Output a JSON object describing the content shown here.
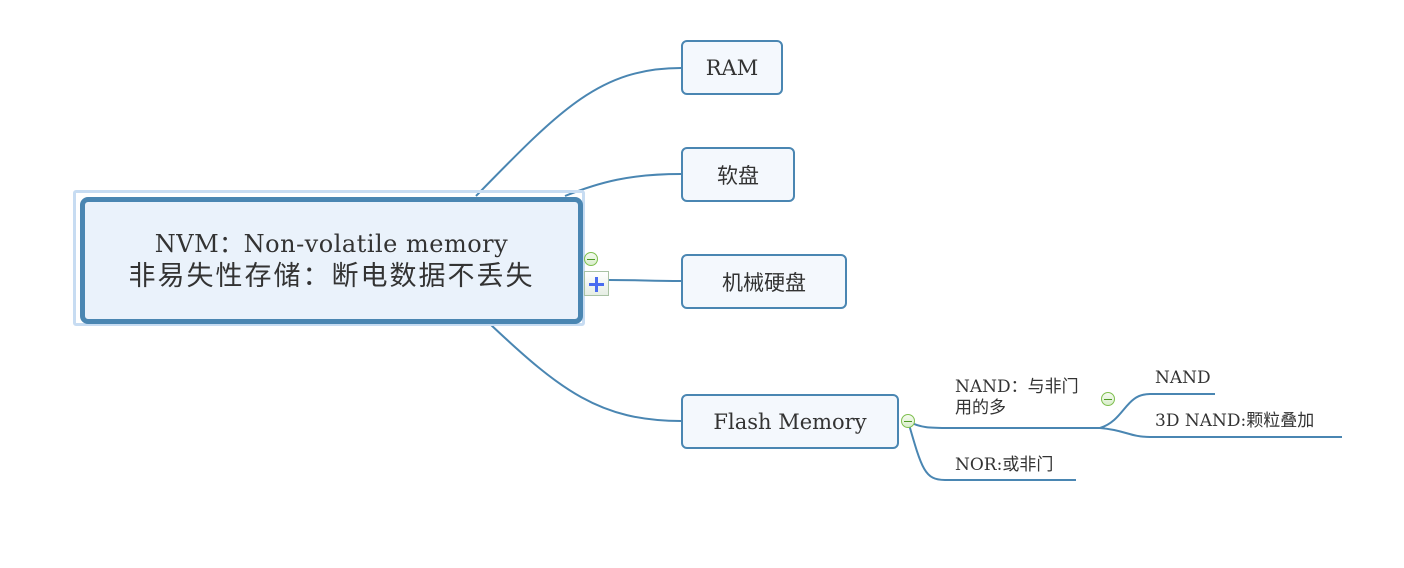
{
  "mindmap": {
    "central": {
      "line1": "NVM：Non-volatile memory",
      "line2": "非易失性存储：断电数据不丢失"
    },
    "topics": [
      {
        "label": "RAM"
      },
      {
        "label": "软盘"
      },
      {
        "label": "机械硬盘"
      },
      {
        "label": "Flash Memory",
        "children": [
          {
            "label_line1": "NAND：与非门",
            "label_line2": "用的多",
            "children": [
              {
                "label": "NAND"
              },
              {
                "label": "3D NAND:颗粒叠加"
              }
            ]
          },
          {
            "label": "NOR:或非门"
          }
        ]
      }
    ],
    "controls": {
      "collapse_icon": "minus-circle-icon",
      "expand_icon": "plus-icon"
    },
    "colors": {
      "connector": "#4a86b2",
      "central_fill": "#eaf2fb",
      "topic_fill": "#f4f8fd",
      "selection": "#c7dcf2",
      "collapse_green": "#7fbf4f",
      "expand_blue": "#4a6cf0"
    }
  }
}
